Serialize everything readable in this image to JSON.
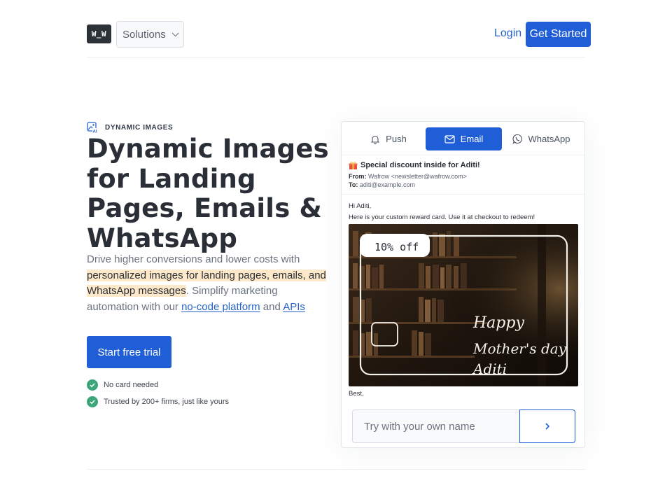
{
  "nav": {
    "logo": "W_W",
    "solutions_label": "Solutions",
    "login_label": "Login",
    "get_started_label": "Get Started"
  },
  "hero": {
    "eyebrow": "DYNAMIC IMAGES",
    "title": "Dynamic Images for Landing Pages, Emails & WhatsApp",
    "desc_part1": "Drive higher conversions and lower costs with ",
    "desc_highlight": "personalized images for landing pages, emails, and WhatsApp messages",
    "desc_part2": ". Simplify marketing automation with our ",
    "desc_link1": "no-code platform",
    "desc_and": " and ",
    "desc_link2": "APIs",
    "cta_label": "Start free trial",
    "checks": [
      "No card needed",
      "Trusted by 200+ firms, just like yours"
    ]
  },
  "preview": {
    "tabs": [
      {
        "label": "Push",
        "icon": "bell-icon"
      },
      {
        "label": "Email",
        "icon": "mail-icon",
        "active": true
      },
      {
        "label": "WhatsApp",
        "icon": "whatsapp-icon"
      }
    ],
    "email": {
      "subject": "Special discount inside for Aditi!",
      "from_label": "From:",
      "from_value": "Wafrow <newsletter@wafrow.com>",
      "to_label": "To:",
      "to_value": "aditi@example.com",
      "greeting": "Hi Aditi,",
      "body": "Here is your custom reward card. Use it at checkout to redeem!",
      "sign_off": "Best,"
    },
    "card": {
      "badge": "10% off",
      "line1": "Happy",
      "line2": "Mother's day",
      "line3": "Aditi"
    },
    "try_placeholder": "Try with your own name"
  },
  "colors": {
    "primary": "#1f5ed6",
    "link": "#2563c9",
    "highlight": "#fde9c9",
    "check": "#3ca57a",
    "text_dark": "#2a2f37"
  }
}
